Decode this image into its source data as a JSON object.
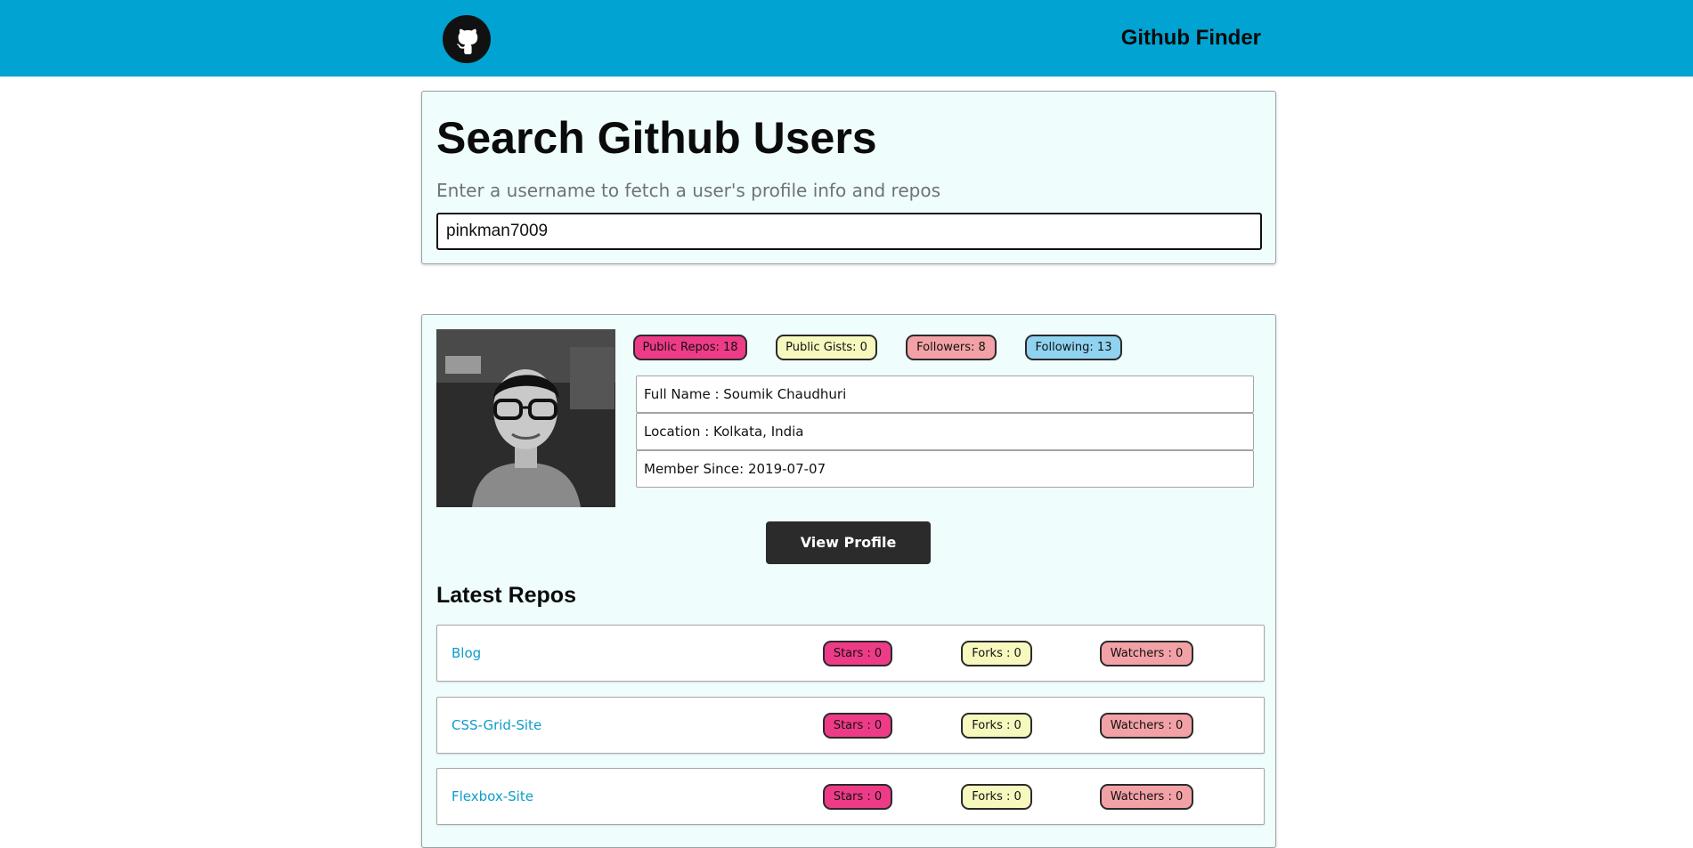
{
  "navbar": {
    "logo_icon": "github-octocat-icon",
    "title": "Github Finder",
    "background": "#01a3d2"
  },
  "search": {
    "title": "Search Github Users",
    "subtitle": "Enter a username to fetch a user's profile info and repos",
    "input_value": "pinkman7009"
  },
  "profile": {
    "avatar_icon": "user-avatar-photo",
    "badges": {
      "public_repos": "Public Repos: 18",
      "public_gists": "Public Gists: 0",
      "followers": "Followers: 8",
      "following": "Following: 13"
    },
    "info": {
      "full_name": "Full Name : Soumik Chaudhuri",
      "location": "Location : Kolkata, India",
      "member_since": "Member Since: 2019-07-07"
    },
    "view_profile_label": "View Profile"
  },
  "repos": {
    "title": "Latest Repos",
    "items": [
      {
        "name": "Blog",
        "stars": "Stars : 0",
        "forks": "Forks : 0",
        "watchers": "Watchers : 0"
      },
      {
        "name": "CSS-Grid-Site",
        "stars": "Stars : 0",
        "forks": "Forks : 0",
        "watchers": "Watchers : 0"
      },
      {
        "name": "Flexbox-Site",
        "stars": "Stars : 0",
        "forks": "Forks : 0",
        "watchers": "Watchers : 0"
      }
    ]
  },
  "colors": {
    "pink_badge": "#ee3b87",
    "yellow_badge": "#f7f8be",
    "salmon_badge": "#f2a2a6",
    "blue_badge": "#8fd3f0",
    "card_background": "#effdfc",
    "link": "#0d9cc8"
  }
}
